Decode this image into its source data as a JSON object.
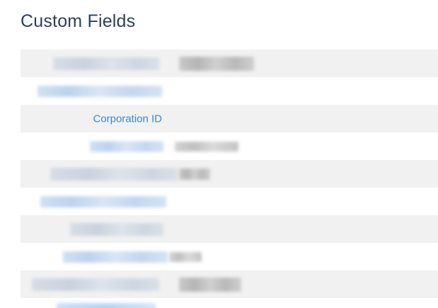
{
  "section": {
    "title": "Custom Fields"
  },
  "fields": [
    {
      "label": "",
      "value": "",
      "label_redacted": true,
      "value_redacted": true
    },
    {
      "label": "",
      "value": "",
      "label_redacted": true,
      "value_redacted": false
    },
    {
      "label": "Corporation ID",
      "value": "",
      "label_redacted": false,
      "value_redacted": false
    },
    {
      "label": "",
      "value": "",
      "label_redacted": true,
      "value_redacted": true
    },
    {
      "label": "",
      "value": "",
      "label_redacted": true,
      "value_redacted": true
    },
    {
      "label": "",
      "value": "",
      "label_redacted": true,
      "value_redacted": false
    },
    {
      "label": "",
      "value": "",
      "label_redacted": true,
      "value_redacted": false
    },
    {
      "label": "",
      "value": "",
      "label_redacted": true,
      "value_redacted": true
    },
    {
      "label": "",
      "value": "",
      "label_redacted": true,
      "value_redacted": true
    }
  ],
  "colors": {
    "title": "#2e3f5a",
    "label_link": "#3b86c8",
    "row_shaded": "#f1f1f1",
    "row_plain": "#ffffff"
  }
}
